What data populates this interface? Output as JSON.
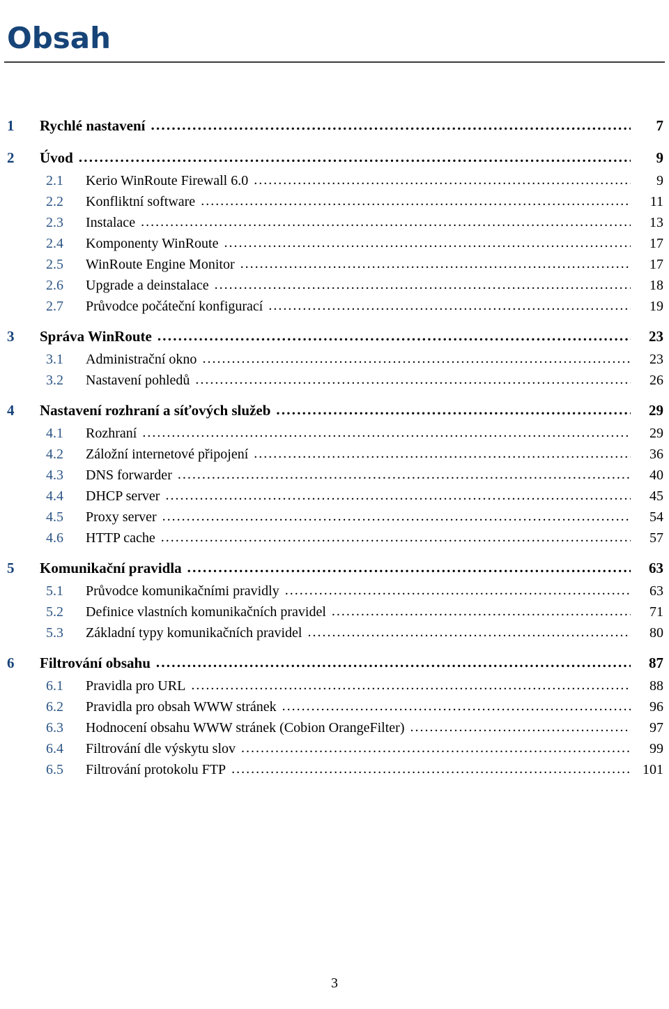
{
  "document": {
    "title": "Obsah",
    "footer_page_number": "3",
    "leader_dot_char": "."
  },
  "colors": {
    "heading_blue": "#174478",
    "chapter_number_blue": "#17437a",
    "section_number_blue": "#2c5585",
    "text_black": "#000000",
    "rule_gray": "#3c3c3c"
  },
  "toc": {
    "groups": [
      {
        "chapter": {
          "number": "1",
          "label": "Rychlé nastavení",
          "page": "7"
        },
        "sections": []
      },
      {
        "chapter": {
          "number": "2",
          "label": "Úvod",
          "page": "9"
        },
        "sections": [
          {
            "number": "2.1",
            "label": "Kerio WinRoute Firewall 6.0",
            "page": "9"
          },
          {
            "number": "2.2",
            "label": "Konfliktní software",
            "page": "11"
          },
          {
            "number": "2.3",
            "label": "Instalace",
            "page": "13"
          },
          {
            "number": "2.4",
            "label": "Komponenty WinRoute",
            "page": "17"
          },
          {
            "number": "2.5",
            "label": "WinRoute Engine Monitor",
            "page": "17"
          },
          {
            "number": "2.6",
            "label": "Upgrade a deinstalace",
            "page": "18"
          },
          {
            "number": "2.7",
            "label": "Průvodce počáteční konfigurací",
            "page": "19"
          }
        ]
      },
      {
        "chapter": {
          "number": "3",
          "label": "Správa WinRoute",
          "page": "23"
        },
        "sections": [
          {
            "number": "3.1",
            "label": "Administrační okno",
            "page": "23"
          },
          {
            "number": "3.2",
            "label": "Nastavení pohledů",
            "page": "26"
          }
        ]
      },
      {
        "chapter": {
          "number": "4",
          "label": "Nastavení rozhraní a síťových služeb",
          "page": "29"
        },
        "sections": [
          {
            "number": "4.1",
            "label": "Rozhraní",
            "page": "29"
          },
          {
            "number": "4.2",
            "label": "Záložní internetové připojení",
            "page": "36"
          },
          {
            "number": "4.3",
            "label": "DNS forwarder",
            "page": "40"
          },
          {
            "number": "4.4",
            "label": "DHCP server",
            "page": "45"
          },
          {
            "number": "4.5",
            "label": "Proxy server",
            "page": "54"
          },
          {
            "number": "4.6",
            "label": "HTTP cache",
            "page": "57"
          }
        ]
      },
      {
        "chapter": {
          "number": "5",
          "label": "Komunikační pravidla",
          "page": "63"
        },
        "sections": [
          {
            "number": "5.1",
            "label": "Průvodce komunikačními pravidly",
            "page": "63"
          },
          {
            "number": "5.2",
            "label": "Definice vlastních komunikačních pravidel",
            "page": "71"
          },
          {
            "number": "5.3",
            "label": "Základní typy komunikačních pravidel",
            "page": "80"
          }
        ]
      },
      {
        "chapter": {
          "number": "6",
          "label": "Filtrování obsahu",
          "page": "87"
        },
        "sections": [
          {
            "number": "6.1",
            "label": "Pravidla pro URL",
            "page": "88"
          },
          {
            "number": "6.2",
            "label": "Pravidla pro obsah WWW stránek",
            "page": "96"
          },
          {
            "number": "6.3",
            "label": "Hodnocení obsahu WWW stránek (Cobion OrangeFilter)",
            "page": "97"
          },
          {
            "number": "6.4",
            "label": "Filtrování dle výskytu slov",
            "page": "99"
          },
          {
            "number": "6.5",
            "label": "Filtrování protokolu FTP",
            "page": "101"
          }
        ]
      }
    ]
  }
}
